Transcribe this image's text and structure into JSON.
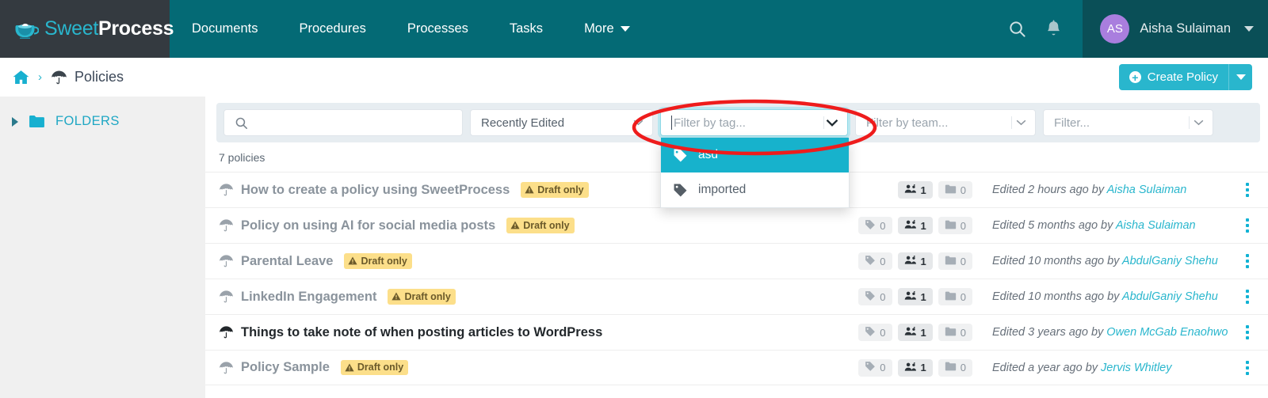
{
  "brand": {
    "part1": "Sweet",
    "part2": "Process",
    "logo_icon": "coffee-cup-icon"
  },
  "topnav": {
    "items": [
      {
        "label": "Documents"
      },
      {
        "label": "Procedures"
      },
      {
        "label": "Processes"
      },
      {
        "label": "Tasks"
      },
      {
        "label": "More",
        "has_caret": true
      }
    ],
    "search_icon": "search-icon",
    "bell_icon": "bell-icon",
    "user": {
      "initials": "AS",
      "name": "Aisha Sulaiman",
      "avatar_color": "#a97ede"
    }
  },
  "breadcrumb": {
    "home_icon": "home-icon",
    "separator": "›",
    "section_icon": "umbrella-icon",
    "section_label": "Policies"
  },
  "create_button": {
    "label": "Create Policy",
    "plus_icon": "plus-circle-icon",
    "caret_icon": "caret-down-icon"
  },
  "sidebar": {
    "chevron_icon": "chevron-right-icon",
    "folder_icon": "folder-icon",
    "label": "FOLDERS"
  },
  "filters": {
    "search": {
      "value": "",
      "placeholder": "",
      "icon": "search-icon"
    },
    "sort": {
      "value": "Recently Edited"
    },
    "tag": {
      "placeholder": "Filter by tag...",
      "value": "",
      "open": true,
      "options": [
        {
          "label": "asd",
          "selected": true,
          "icon": "tag-icon"
        },
        {
          "label": "imported",
          "selected": false,
          "icon": "tag-icon"
        }
      ]
    },
    "team": {
      "placeholder": "Filter by team...",
      "value": ""
    },
    "other": {
      "placeholder": "Filter...",
      "value": ""
    }
  },
  "list": {
    "count_label": "7 policies",
    "rows": [
      {
        "icon": "umbrella-icon",
        "title": "How to create a policy using SweetProcess",
        "badge": "Draft only",
        "published": false,
        "tags": "",
        "teams": "1",
        "folders": "0",
        "edited": "Edited 2 hours ago by ",
        "author": "Aisha Sulaiman"
      },
      {
        "icon": "umbrella-icon",
        "title": "Policy on using AI for social media posts",
        "badge": "Draft only",
        "published": false,
        "tags": "0",
        "teams": "1",
        "folders": "0",
        "edited": "Edited 5 months ago by ",
        "author": "Aisha Sulaiman"
      },
      {
        "icon": "umbrella-icon",
        "title": "Parental Leave",
        "badge": "Draft only",
        "published": false,
        "tags": "0",
        "teams": "1",
        "folders": "0",
        "edited": "Edited 10 months ago by ",
        "author": "AbdulGaniy Shehu"
      },
      {
        "icon": "umbrella-icon",
        "title": "LinkedIn Engagement",
        "badge": "Draft only",
        "published": false,
        "tags": "0",
        "teams": "1",
        "folders": "0",
        "edited": "Edited 10 months ago by ",
        "author": "AbdulGaniy Shehu"
      },
      {
        "icon": "umbrella-icon",
        "title": "Things to take note of when posting articles to WordPress",
        "badge": "",
        "published": true,
        "tags": "0",
        "teams": "1",
        "folders": "0",
        "edited": "Edited 3 years ago by ",
        "author": "Owen McGab Enaohwo"
      },
      {
        "icon": "umbrella-icon",
        "title": "Policy Sample",
        "badge": "Draft only",
        "published": false,
        "tags": "0",
        "teams": "1",
        "folders": "0",
        "edited": "Edited a year ago by ",
        "author": "Jervis Whitley"
      }
    ],
    "chip_icons": {
      "tag": "tag-icon",
      "team": "team-icon",
      "folder": "folder-icon"
    },
    "kebab_icon": "more-vertical-icon",
    "badge_icon": "warning-triangle-icon"
  },
  "annotation": {
    "shape": "ellipse",
    "color": "#ee1c1c",
    "target": "tag-filter-dropdown"
  },
  "colors": {
    "nav_bg": "#046a75",
    "brand_bg": "#343a40",
    "accent": "#29b6cd",
    "badge_bg": "#fcdf8a",
    "dropdown_selected": "#17b2cc",
    "sidebar_bg": "#f0f0f0",
    "filterbar_bg": "#e7edf1"
  }
}
